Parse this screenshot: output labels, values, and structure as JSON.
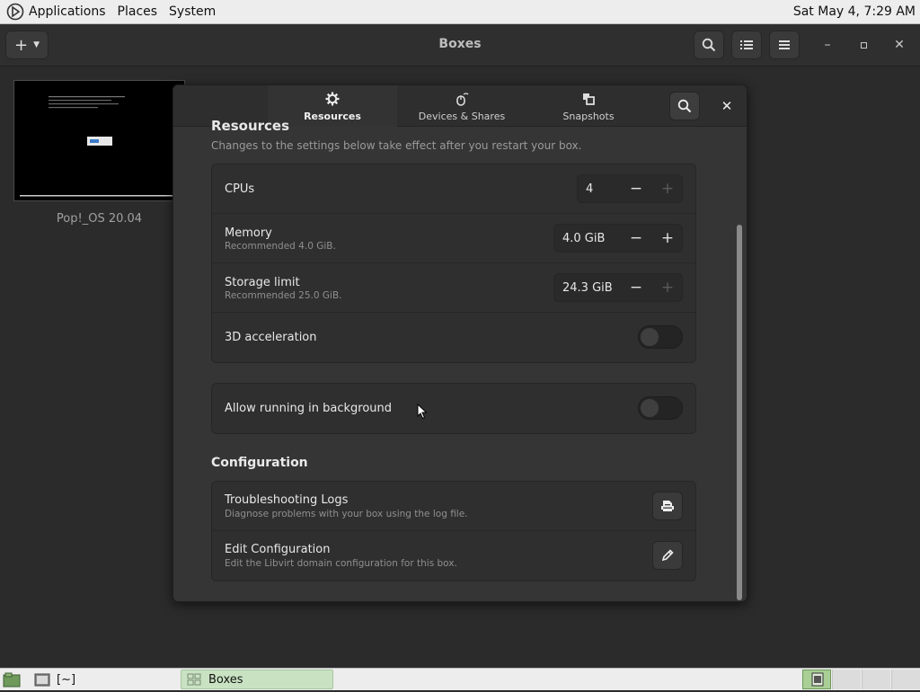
{
  "top_panel": {
    "menus": [
      "Applications",
      "Places",
      "System"
    ],
    "clock": "Sat May  4,  7:29 AM"
  },
  "window": {
    "title": "Boxes"
  },
  "vm": {
    "name": "Pop!_OS 20.04"
  },
  "dialog": {
    "tabs": [
      {
        "label": "Resources",
        "icon": "gear-icon",
        "active": true
      },
      {
        "label": "Devices & Shares",
        "icon": "mouse-icon",
        "active": false
      },
      {
        "label": "Snapshots",
        "icon": "snapshots-icon",
        "active": false
      }
    ],
    "resources": {
      "heading": "Resources",
      "subtitle": "Changes to the settings below take effect after you restart your box.",
      "cpus": {
        "label": "CPUs",
        "value": "4"
      },
      "memory": {
        "label": "Memory",
        "hint": "Recommended 4.0 GiB.",
        "value": "4.0 GiB"
      },
      "storage": {
        "label": "Storage limit",
        "hint": "Recommended 25.0 GiB.",
        "value": "24.3 GiB"
      },
      "accel": {
        "label": "3D acceleration",
        "enabled": false
      },
      "background": {
        "label": "Allow running in background",
        "enabled": false
      }
    },
    "configuration": {
      "heading": "Configuration",
      "logs": {
        "label": "Troubleshooting Logs",
        "hint": "Diagnose problems with your box using the log file."
      },
      "edit": {
        "label": "Edit Configuration",
        "hint": "Edit the Libvirt domain configuration for this box."
      }
    }
  },
  "bottom_panel": {
    "terminal_label": "[~]",
    "task_label": "Boxes"
  }
}
